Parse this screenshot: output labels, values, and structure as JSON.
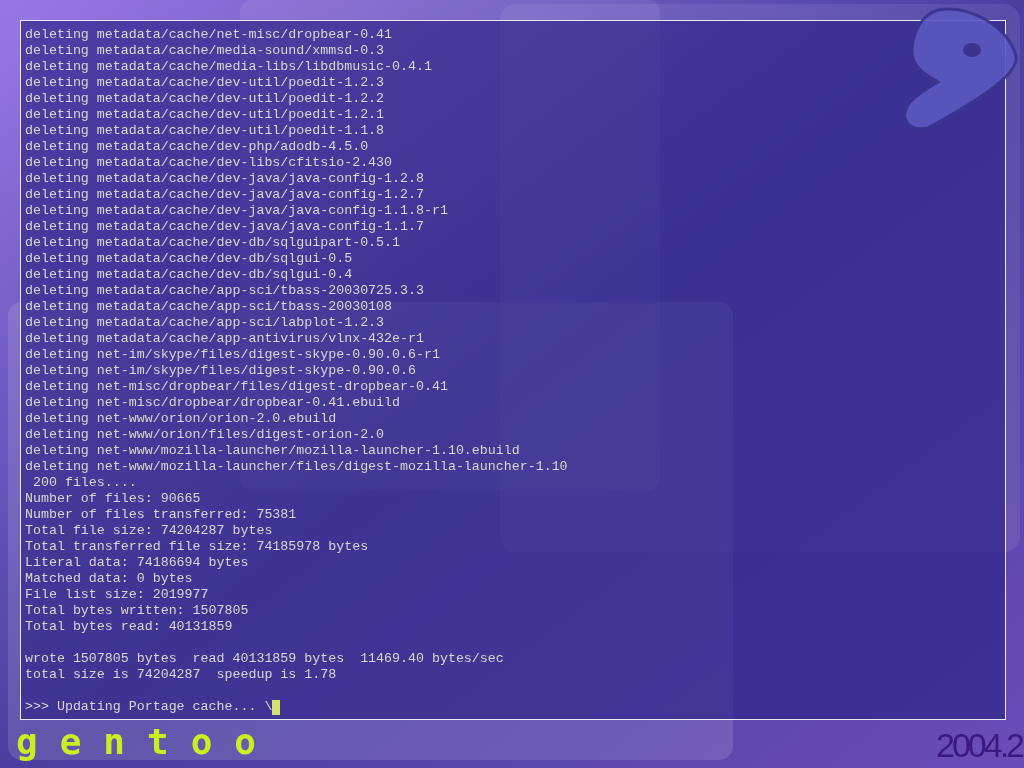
{
  "console": {
    "blocks": [
      [
        "deleting metadata/cache/net-misc/dropbear-0.41",
        "deleting metadata/cache/media-sound/xmmsd-0.3",
        "deleting metadata/cache/media-libs/libdbmusic-0.4.1",
        "deleting metadata/cache/dev-util/poedit-1.2.3",
        "deleting metadata/cache/dev-util/poedit-1.2.2",
        "deleting metadata/cache/dev-util/poedit-1.2.1",
        "deleting metadata/cache/dev-util/poedit-1.1.8",
        "deleting metadata/cache/dev-php/adodb-4.5.0",
        "deleting metadata/cache/dev-libs/cfitsio-2.430",
        "deleting metadata/cache/dev-java/java-config-1.2.8",
        "deleting metadata/cache/dev-java/java-config-1.2.7",
        "deleting metadata/cache/dev-java/java-config-1.1.8-r1",
        "deleting metadata/cache/dev-java/java-config-1.1.7",
        "deleting metadata/cache/dev-db/sqlguipart-0.5.1",
        "deleting metadata/cache/dev-db/sqlgui-0.5",
        "deleting metadata/cache/dev-db/sqlgui-0.4",
        "deleting metadata/cache/app-sci/tbass-20030725.3.3",
        "deleting metadata/cache/app-sci/tbass-20030108",
        "deleting metadata/cache/app-sci/labplot-1.2.3",
        "deleting metadata/cache/app-antivirus/vlnx-432e-r1",
        "deleting net-im/skype/files/digest-skype-0.90.0.6-r1",
        "deleting net-im/skype/files/digest-skype-0.90.0.6",
        "deleting net-misc/dropbear/files/digest-dropbear-0.41",
        "deleting net-misc/dropbear/dropbear-0.41.ebuild",
        "deleting net-www/orion/orion-2.0.ebuild",
        "deleting net-www/orion/files/digest-orion-2.0",
        "deleting net-www/mozilla-launcher/mozilla-launcher-1.10.ebuild",
        "deleting net-www/mozilla-launcher/files/digest-mozilla-launcher-1.10",
        " 200 files....",
        "Number of files: 90665",
        "Number of files transferred: 75381",
        "Total file size: 74204287 bytes",
        "Total transferred file size: 74185978 bytes",
        "Literal data: 74186694 bytes",
        "Matched data: 0 bytes",
        "File list size: 2019977",
        "Total bytes written: 1507805",
        "Total bytes read: 40131859"
      ],
      [
        "wrote 1507805 bytes  read 40131859 bytes  11469.40 bytes/sec",
        "total size is 74204287  speedup is 1.78"
      ]
    ],
    "prompt": ">>> Updating Portage cache... \\"
  },
  "logo_text": "gentoo",
  "version": "2004.2"
}
